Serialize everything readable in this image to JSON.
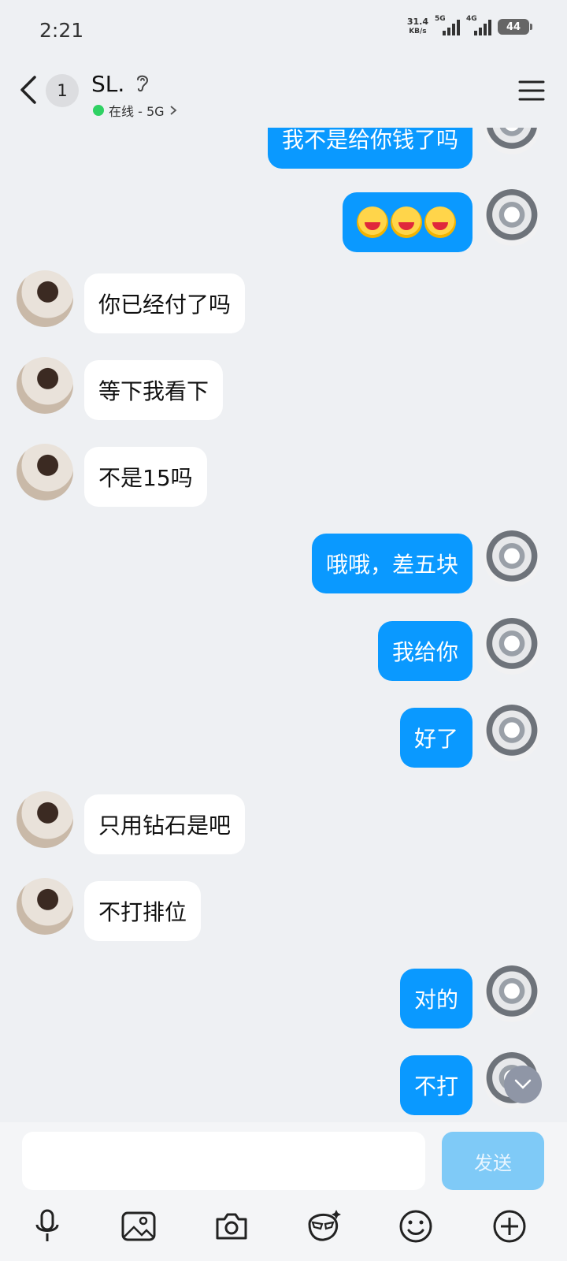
{
  "status_bar": {
    "time": "2:21",
    "net_speed_value": "31.4",
    "net_speed_unit": "KB/s",
    "signal1_label": "5G",
    "signal2_label": "4G",
    "battery": "44"
  },
  "header": {
    "unread_count": "1",
    "contact_name": "SL.",
    "presence_text": "在线 - 5G",
    "presence_color": "#2fd163"
  },
  "messages": [
    {
      "side": "me",
      "text": "我不是给你钱了吗"
    },
    {
      "side": "me",
      "text": "",
      "emoji_count": 3,
      "emoji_name": "laugh-cry-emoji"
    },
    {
      "side": "other",
      "text": "你已经付了吗"
    },
    {
      "side": "other",
      "text": "等下我看下"
    },
    {
      "side": "other",
      "text": "不是15吗"
    },
    {
      "side": "me",
      "text": "哦哦，差五块"
    },
    {
      "side": "me",
      "text": "我给你"
    },
    {
      "side": "me",
      "text": "好了"
    },
    {
      "side": "other",
      "text": "只用钻石是吧"
    },
    {
      "side": "other",
      "text": "不打排位"
    },
    {
      "side": "me",
      "text": "对的"
    },
    {
      "side": "me",
      "text": "不打"
    }
  ],
  "input": {
    "text_value": "",
    "send_label": "发送"
  },
  "toolbar_icons": [
    "microphone-icon",
    "image-icon",
    "camera-icon",
    "sticker-face-icon",
    "emoji-icon",
    "plus-icon"
  ],
  "colors": {
    "my_bubble": "#0a99ff",
    "other_bubble": "#ffffff",
    "background": "#eef0f3",
    "send_disabled": "#7fcaf7"
  }
}
